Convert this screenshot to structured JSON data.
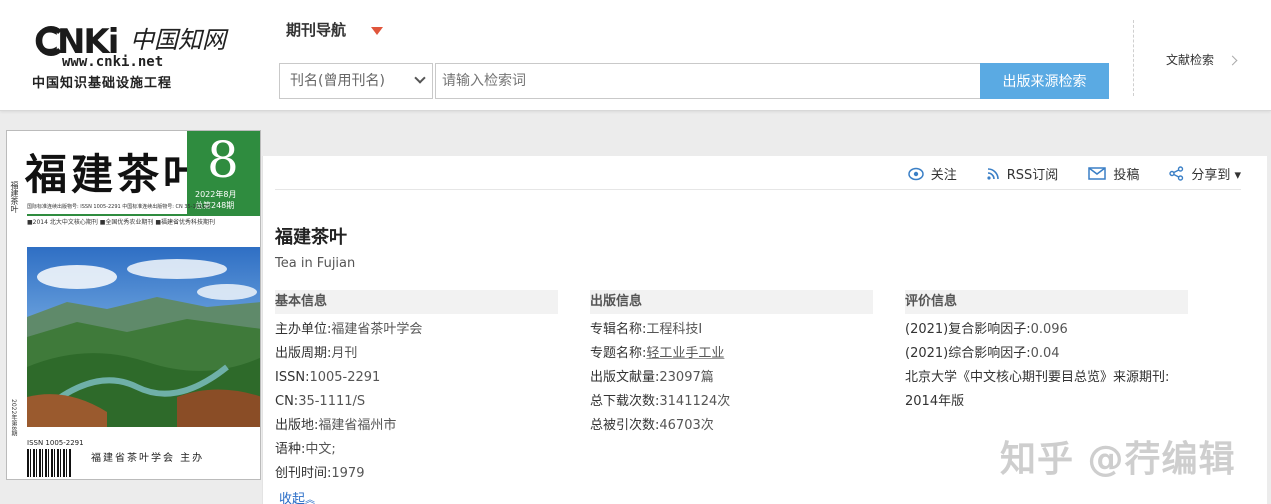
{
  "header": {
    "logo": {
      "brand": "CNKi",
      "cn_name": "中国知网",
      "url": "www.cnki.net",
      "subtitle": "中国知识基础设施工程"
    },
    "nav_label": "期刊导航",
    "select_value": "刊名(曾用刊名)",
    "search_placeholder": "请输入检索词",
    "search_button": "出版来源检索",
    "literature_search": "文献检索"
  },
  "cover": {
    "title": "福建茶叶",
    "side_text": "福建茶叶",
    "issue_number": "8",
    "issue_date": "2022年8月",
    "issue_total": "总第248期",
    "info_line": "国际标准连续出版物号: ISSN 1005-2291   中国标准连续出版物号: CN 35-1111/S",
    "tags": "■2014 北大中文核心期刊   ■全国优秀农业期刊   ■福建省优秀科技期刊",
    "issn": "ISSN 1005-2291",
    "publisher": "福建省茶叶学会  主办",
    "vertical_text": "2022年第8期"
  },
  "actions": {
    "follow": "关注",
    "rss": "RSS订阅",
    "submit": "投稿",
    "share": "分享到 ▾"
  },
  "journal": {
    "title": "福建茶叶",
    "english_title": "Tea in Fujian"
  },
  "basic_info": {
    "heading": "基本信息",
    "rows": [
      {
        "key": "主办单位:",
        "value": "福建省茶叶学会"
      },
      {
        "key": "出版周期:",
        "value": "月刊"
      },
      {
        "key": "ISSN:",
        "value": "1005-2291"
      },
      {
        "key": "CN:",
        "value": "35-1111/S"
      },
      {
        "key": "出版地:",
        "value": "福建省福州市"
      },
      {
        "key": "语种:",
        "value": "中文;"
      },
      {
        "key": "创刊时间:",
        "value": "1979"
      }
    ]
  },
  "publish_info": {
    "heading": "出版信息",
    "rows": [
      {
        "key": "专辑名称:",
        "value": "工程科技Ⅰ"
      },
      {
        "key": "专题名称:",
        "value": "轻工业手工业"
      },
      {
        "key": "出版文献量:",
        "value": "23097篇"
      },
      {
        "key": "总下载次数:",
        "value": "3141124次"
      },
      {
        "key": "总被引次数:",
        "value": "46703次"
      }
    ]
  },
  "eval_info": {
    "heading": "评价信息",
    "rows": [
      {
        "key": "(2021)复合影响因子:",
        "value": "0.096"
      },
      {
        "key": "(2021)综合影响因子:",
        "value": "0.04"
      },
      {
        "key": "北京大学《中文核心期刊要目总览》来源期刊:",
        "value": ""
      },
      {
        "key": "2014年版",
        "value": ""
      }
    ]
  },
  "collapse_label": "收起",
  "watermark": "知乎 @荇编辑"
}
